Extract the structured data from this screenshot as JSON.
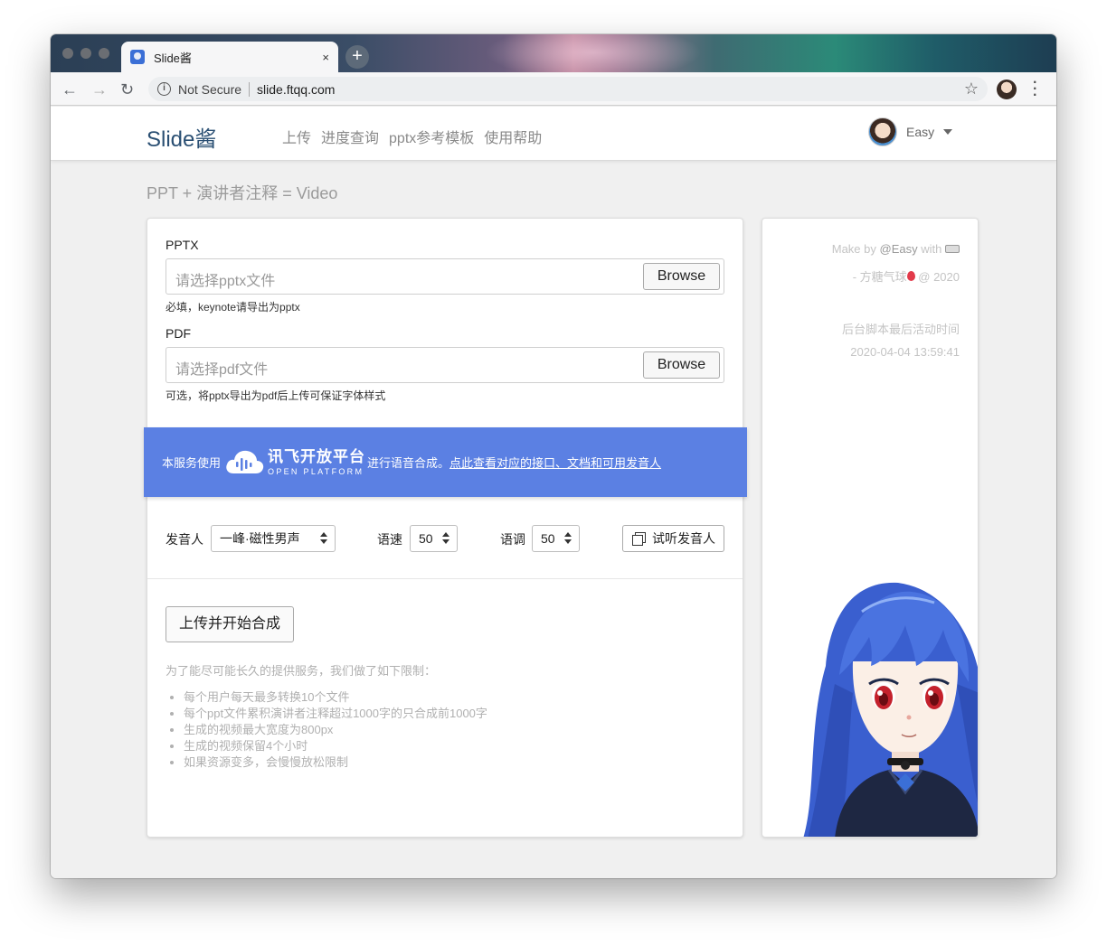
{
  "browser": {
    "tab_title": "Slide酱",
    "tab_close": "×",
    "new_tab": "+",
    "security_label": "Not Secure",
    "url": "slide.ftqq.com"
  },
  "navbar": {
    "brand": "Slide酱",
    "links": [
      "上传",
      "进度查询",
      "pptx参考模板",
      "使用帮助"
    ],
    "user_name": "Easy"
  },
  "subtitle": "PPT + 演讲者注释 = Video",
  "form": {
    "pptx": {
      "label": "PPTX",
      "placeholder": "请选择pptx文件",
      "browse": "Browse",
      "help": "必填，keynote请导出为pptx"
    },
    "pdf": {
      "label": "PDF",
      "placeholder": "请选择pdf文件",
      "browse": "Browse",
      "help": "可选，将pptx导出为pdf后上传可保证字体样式"
    }
  },
  "banner": {
    "prefix": "本服务使用",
    "logo_cn": "讯飞开放平台",
    "logo_en": "OPEN PLATFORM",
    "middle": "进行语音合成。",
    "link": "点此查看对应的接口、文档和可用发音人",
    "color": "#5b80e3"
  },
  "controls": {
    "speaker_label": "发音人",
    "speaker_value": "一峰·磁性男声",
    "speed_label": "语速",
    "speed_value": "50",
    "pitch_label": "语调",
    "pitch_value": "50",
    "listen_button": "试听发音人"
  },
  "upload_button": "上传并开始合成",
  "limits": {
    "intro": "为了能尽可能长久的提供服务，我们做了如下限制：",
    "items": [
      "每个用户每天最多转换10个文件",
      "每个ppt文件累积演讲者注释超过1000字的只合成前1000字",
      "生成的视频最大宽度为800px",
      "生成的视频保留4个小时",
      "如果资源变多，会慢慢放松限制"
    ]
  },
  "sidebar": {
    "made_by_prefix": "Make by",
    "made_by_handle": "@Easy",
    "made_by_with": "with",
    "author_line": "- 方糖气球",
    "copyright": "@ 2020",
    "last_active_label": "后台脚本最后活动时间",
    "last_active_time": "2020-04-04 13:59:41"
  }
}
